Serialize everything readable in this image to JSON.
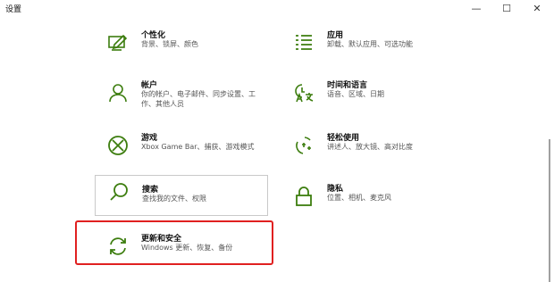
{
  "window": {
    "title": "设置",
    "minimize_glyph": "—",
    "maximize_glyph": "☐",
    "close_glyph": "✕"
  },
  "accent_color": "#3c7d0e",
  "tiles": [
    {
      "icon": "personalization-icon",
      "name": "个性化",
      "desc": "背景、锁屏、颜色"
    },
    {
      "icon": "apps-icon",
      "name": "应用",
      "desc": "卸载、默认应用、可选功能"
    },
    {
      "icon": "accounts-icon",
      "name": "帐户",
      "desc": "你的帐户、电子邮件、同步设置、工作、其他人员"
    },
    {
      "icon": "time-language-icon",
      "name": "时间和语言",
      "desc": "语音、区域、日期"
    },
    {
      "icon": "gaming-icon",
      "name": "游戏",
      "desc": "Xbox Game Bar、捕获、游戏模式"
    },
    {
      "icon": "ease-of-access-icon",
      "name": "轻松使用",
      "desc": "讲述人、放大镜、高对比度"
    },
    {
      "icon": "search-icon",
      "name": "搜索",
      "desc": "查找我的文件、权限"
    },
    {
      "icon": "privacy-lock-icon",
      "name": "隐私",
      "desc": "位置、相机、麦克风"
    },
    {
      "icon": "update-security-icon",
      "name": "更新和安全",
      "desc": "Windows 更新、恢复、备份"
    }
  ]
}
